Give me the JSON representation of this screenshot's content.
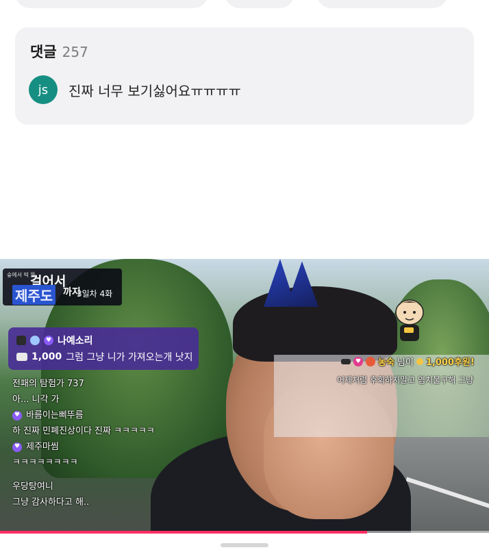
{
  "comments": {
    "title": "댓글",
    "count": "257",
    "items": [
      {
        "avatar_initials": "js",
        "avatar_color": "#168f82",
        "text": "진짜 너무 보기싫어요ㅠㅠㅠㅠ"
      }
    ]
  },
  "video": {
    "series_badge": {
      "line1": "숲에서 떡 뜰",
      "line2": "걸어서",
      "line3": "제주도",
      "line4": "까지",
      "line5": "3일차 4화"
    },
    "donation_box": {
      "name": "나예소리",
      "amount": "1,000",
      "message": "그럼 그냥 니가 가져오는개 낫지"
    },
    "chat": [
      {
        "badge": false,
        "text": "전패의 탐험가 737"
      },
      {
        "badge": false,
        "text": "아... 니각 가"
      },
      {
        "badge": true,
        "text": "바름이는삐뚜름"
      },
      {
        "badge": false,
        "text": "하 진짜 민폐진상이다 진짜 ㅋㅋㅋㅋㅋ"
      },
      {
        "badge": true,
        "text": "제주마씸"
      },
      {
        "badge": false,
        "text": "ㅋㅋㅋㅋㅋㅋㅋㅋ"
      },
      {
        "badge": false,
        "text": "우당탕여니"
      },
      {
        "badge": false,
        "text": "그냥 감사하다고 해.."
      }
    ],
    "alert": {
      "name": "농숙",
      "suffix": "님이",
      "amount": "1,000후원!",
      "message": "어제처럼 후회하지말고 염치불구해 그냥"
    },
    "progress_fraction": 0.75,
    "accent_color": "#ff2e63"
  }
}
